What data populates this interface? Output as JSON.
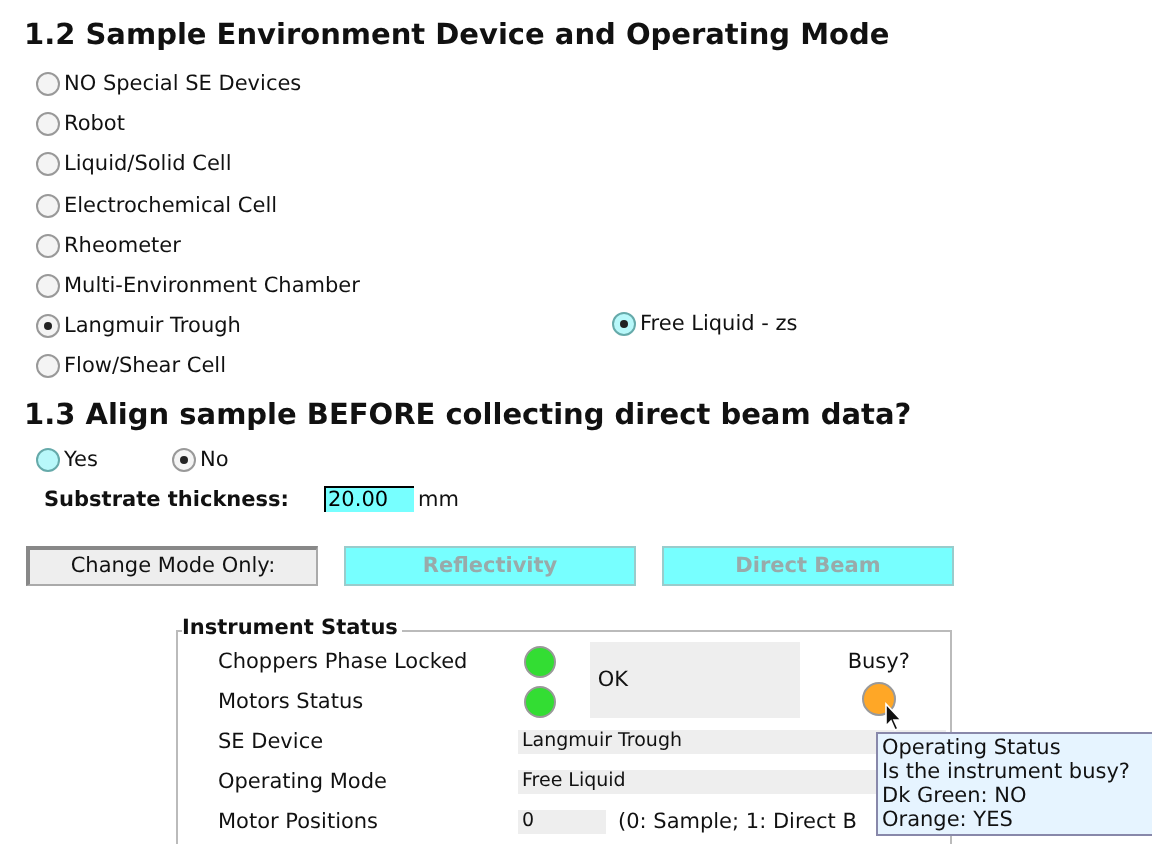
{
  "section_device": {
    "title": "1.2 Sample Environment Device and Operating Mode",
    "devices": [
      {
        "label": "NO Special SE Devices",
        "selected": false
      },
      {
        "label": "Robot",
        "selected": false
      },
      {
        "label": "Liquid/Solid Cell",
        "selected": false
      },
      {
        "label": "Electrochemical Cell",
        "selected": false
      },
      {
        "label": "Rheometer",
        "selected": false
      },
      {
        "label": "Multi-Environment Chamber",
        "selected": false
      },
      {
        "label": "Langmuir Trough",
        "selected": true,
        "modes": [
          {
            "label": "Free Liquid - zs",
            "selected": true,
            "highlighted": true
          }
        ]
      },
      {
        "label": "Flow/Shear Cell",
        "selected": false
      }
    ]
  },
  "section_align": {
    "title": "1.3 Align sample BEFORE collecting direct beam data?",
    "options": [
      {
        "label": "Yes",
        "selected": false,
        "highlighted": true
      },
      {
        "label": "No",
        "selected": true,
        "highlighted": false
      }
    ],
    "substrate": {
      "label": "Substrate thickness:",
      "value": "20.00",
      "unit": "mm"
    }
  },
  "buttons": [
    {
      "label": "Change Mode Only:",
      "kind": "toggle",
      "disabled": false
    },
    {
      "label": "Reflectivity",
      "kind": "action",
      "disabled": true
    },
    {
      "label": "Direct Beam",
      "kind": "action",
      "disabled": true
    }
  ],
  "instrument_status": {
    "title": "Instrument Status",
    "lamps": [
      {
        "label": "Choppers Phase Locked",
        "color": "#33dd33"
      },
      {
        "label": "Motors Status",
        "color": "#33dd33"
      }
    ],
    "message": "OK",
    "busy": {
      "label": "Busy?",
      "color": "#ffa726"
    },
    "fields": [
      {
        "label": "SE Device",
        "value": "Langmuir Trough"
      },
      {
        "label": "Operating Mode",
        "value": "Free Liquid"
      },
      {
        "label": "Motor Positions",
        "value": "0",
        "note": "(0: Sample; 1: Direct B"
      }
    ]
  },
  "tooltip": {
    "lines": [
      "Operating Status",
      "Is the instrument busy?",
      "Dk Green: NO",
      "Orange: YES"
    ]
  }
}
